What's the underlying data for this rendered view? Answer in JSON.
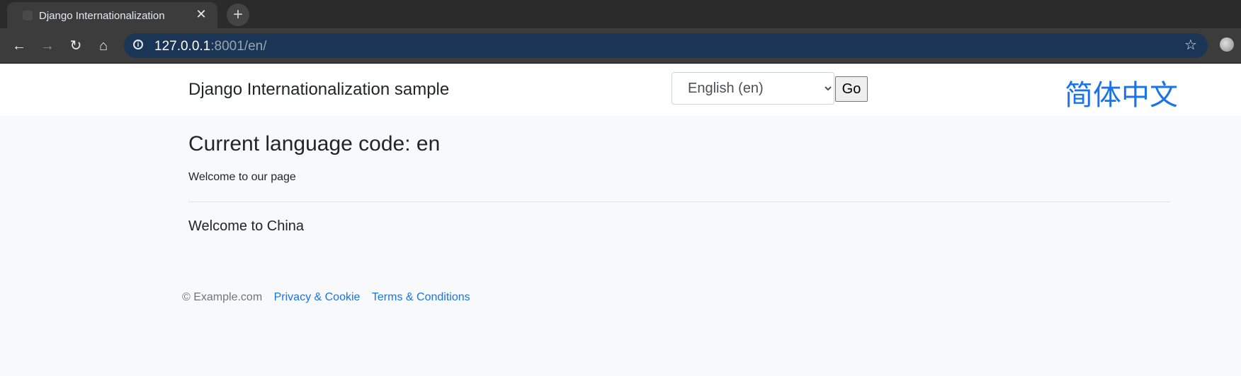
{
  "browser": {
    "tab": {
      "title": "Django Internationalization",
      "close": "✕"
    },
    "new_tab": "+",
    "nav": {
      "back": "←",
      "forward": "→",
      "reload": "↻",
      "home": "⌂"
    },
    "address": {
      "host": "127.0.0.1",
      "rest": ":8001/en/"
    },
    "icons": [
      "info-icon",
      "star-icon",
      "extension-icon"
    ],
    "bookmark": "☆"
  },
  "page": {
    "brand": "Django Internationalization sample",
    "language_select": {
      "selected": "English (en)"
    },
    "go_label": "Go",
    "alt_language_link": "简体中文",
    "heading": "Current language code: en",
    "welcome": "Welcome to our page",
    "welcome_china": "Welcome to China",
    "footer": {
      "copyright": "© Example.com",
      "privacy": "Privacy & Cookie",
      "terms": "Terms & Conditions"
    }
  },
  "colors": {
    "link": "#1a73e8",
    "omnibox_bg": "#1a3555",
    "page_bg": "#f8f9fa"
  }
}
